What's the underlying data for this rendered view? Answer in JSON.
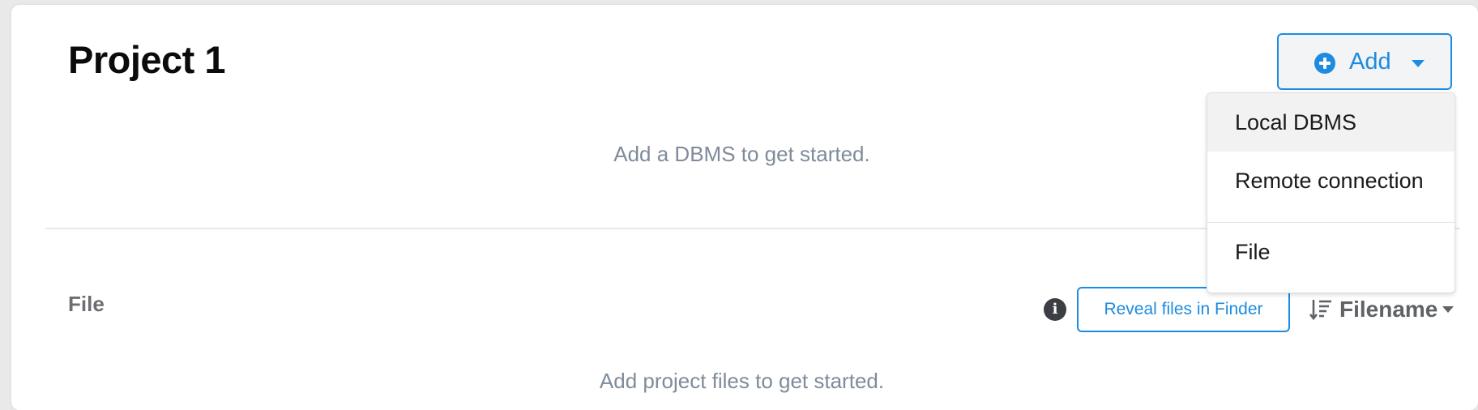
{
  "project": {
    "title": "Project 1",
    "empty_dbms_text": "Add a DBMS to get started."
  },
  "add_button": {
    "label": "Add",
    "icon": "plus-circle-icon",
    "caret_icon": "caret-down-icon"
  },
  "dropdown": {
    "items": [
      {
        "label": "Local DBMS",
        "highlighted": true
      },
      {
        "label": "Remote connection",
        "highlighted": false
      },
      {
        "label": "File",
        "highlighted": false
      }
    ]
  },
  "files_section": {
    "label": "File",
    "info_icon": "info-icon",
    "reveal_button": "Reveal files in Finder",
    "sort": {
      "icon": "sort-descending-icon",
      "label": "Filename",
      "caret_icon": "caret-down-icon"
    },
    "empty_text": "Add project files to get started."
  },
  "colors": {
    "accent": "#1d8be0",
    "muted_text": "#7f8b9a",
    "title_text": "#0b0b0b",
    "menu_hover": "#f2f2f2"
  }
}
